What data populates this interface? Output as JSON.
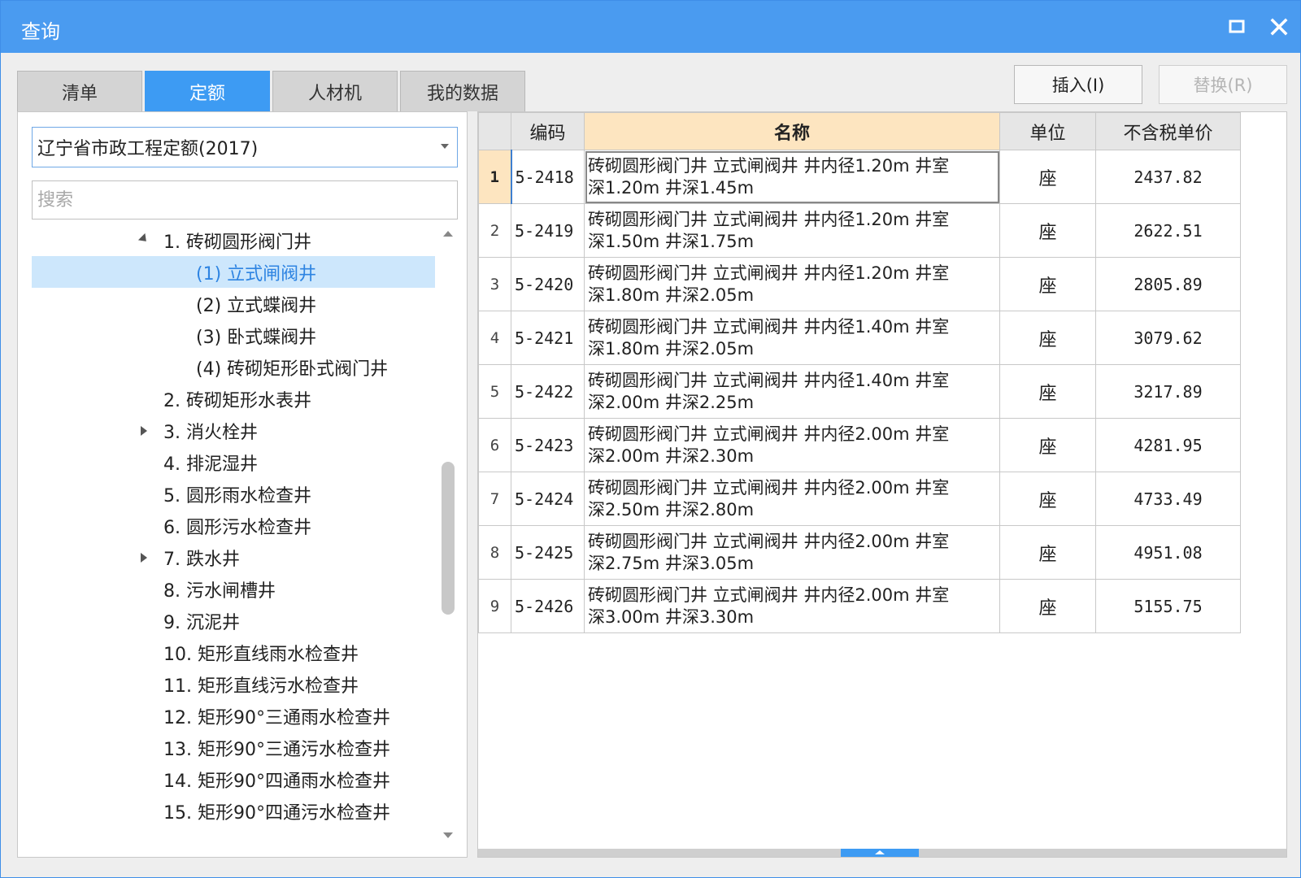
{
  "window": {
    "title": "查询",
    "colors": {
      "titlebar": "#4a9bf0",
      "active_tab": "#3d9bf3",
      "selected_row": "#cde7fc",
      "header_highlight": "#fde5c0"
    }
  },
  "tabs": [
    {
      "label": "清单",
      "active": false
    },
    {
      "label": "定额",
      "active": true
    },
    {
      "label": "人材机",
      "active": false
    },
    {
      "label": "我的数据",
      "active": false
    }
  ],
  "actions": {
    "insert_label": "插入(I)",
    "replace_label": "替换(R)"
  },
  "library": {
    "selected": "辽宁省市政工程定额(2017)"
  },
  "search": {
    "placeholder": "搜索",
    "value": ""
  },
  "tree": [
    {
      "label": "1. 砖砌圆形阀门井",
      "level": 1,
      "arrow": "expanded",
      "selected": false
    },
    {
      "label": "(1) 立式闸阀井",
      "level": 2,
      "arrow": "",
      "selected": true
    },
    {
      "label": "(2) 立式蝶阀井",
      "level": 2,
      "arrow": "",
      "selected": false
    },
    {
      "label": "(3) 卧式蝶阀井",
      "level": 2,
      "arrow": "",
      "selected": false
    },
    {
      "label": "(4) 砖砌矩形卧式阀门井",
      "level": 2,
      "arrow": "",
      "selected": false
    },
    {
      "label": "2. 砖砌矩形水表井",
      "level": 1,
      "arrow": "",
      "selected": false
    },
    {
      "label": "3. 消火栓井",
      "level": 1,
      "arrow": "collapsed",
      "selected": false
    },
    {
      "label": "4. 排泥湿井",
      "level": 1,
      "arrow": "",
      "selected": false
    },
    {
      "label": "5. 圆形雨水检查井",
      "level": 1,
      "arrow": "",
      "selected": false
    },
    {
      "label": "6. 圆形污水检查井",
      "level": 1,
      "arrow": "",
      "selected": false
    },
    {
      "label": "7. 跌水井",
      "level": 1,
      "arrow": "collapsed",
      "selected": false
    },
    {
      "label": "8. 污水闸槽井",
      "level": 1,
      "arrow": "",
      "selected": false
    },
    {
      "label": "9. 沉泥井",
      "level": 1,
      "arrow": "",
      "selected": false
    },
    {
      "label": "10. 矩形直线雨水检查井",
      "level": 1,
      "arrow": "",
      "selected": false
    },
    {
      "label": "11. 矩形直线污水检查井",
      "level": 1,
      "arrow": "",
      "selected": false
    },
    {
      "label": "12. 矩形90°三通雨水检查井",
      "level": 1,
      "arrow": "",
      "selected": false
    },
    {
      "label": "13. 矩形90°三通污水检查井",
      "level": 1,
      "arrow": "",
      "selected": false
    },
    {
      "label": "14. 矩形90°四通雨水检查井",
      "level": 1,
      "arrow": "",
      "selected": false
    },
    {
      "label": "15. 矩形90°四通污水检查井",
      "level": 1,
      "arrow": "",
      "selected": false
    }
  ],
  "table": {
    "headers": [
      "",
      "编码",
      "名称",
      "单位",
      "不含税单价"
    ],
    "rows": [
      {
        "index": "1",
        "code": "5-2418",
        "name_line1": "砖砌圆形阀门井 立式闸阀井 井内径1.20m 井室",
        "name_line2": "深1.20m 井深1.45m",
        "unit": "座",
        "price": "2437.82"
      },
      {
        "index": "2",
        "code": "5-2419",
        "name_line1": "砖砌圆形阀门井 立式闸阀井 井内径1.20m 井室",
        "name_line2": "深1.50m 井深1.75m",
        "unit": "座",
        "price": "2622.51"
      },
      {
        "index": "3",
        "code": "5-2420",
        "name_line1": "砖砌圆形阀门井 立式闸阀井 井内径1.20m 井室",
        "name_line2": "深1.80m 井深2.05m",
        "unit": "座",
        "price": "2805.89"
      },
      {
        "index": "4",
        "code": "5-2421",
        "name_line1": "砖砌圆形阀门井 立式闸阀井 井内径1.40m 井室",
        "name_line2": "深1.80m 井深2.05m",
        "unit": "座",
        "price": "3079.62"
      },
      {
        "index": "5",
        "code": "5-2422",
        "name_line1": "砖砌圆形阀门井 立式闸阀井 井内径1.40m 井室",
        "name_line2": "深2.00m 井深2.25m",
        "unit": "座",
        "price": "3217.89"
      },
      {
        "index": "6",
        "code": "5-2423",
        "name_line1": "砖砌圆形阀门井 立式闸阀井 井内径2.00m 井室",
        "name_line2": "深2.00m 井深2.30m",
        "unit": "座",
        "price": "4281.95"
      },
      {
        "index": "7",
        "code": "5-2424",
        "name_line1": "砖砌圆形阀门井 立式闸阀井 井内径2.00m 井室",
        "name_line2": "深2.50m 井深2.80m",
        "unit": "座",
        "price": "4733.49"
      },
      {
        "index": "8",
        "code": "5-2425",
        "name_line1": "砖砌圆形阀门井 立式闸阀井 井内径2.00m 井室",
        "name_line2": "深2.75m 井深3.05m",
        "unit": "座",
        "price": "4951.08"
      },
      {
        "index": "9",
        "code": "5-2426",
        "name_line1": "砖砌圆形阀门井 立式闸阀井 井内径2.00m 井室",
        "name_line2": "深3.00m 井深3.30m",
        "unit": "座",
        "price": "5155.75"
      }
    ]
  },
  "icons": {
    "maximize": "maximize-icon",
    "close": "close-icon",
    "dropdown": "chevron-down-icon"
  }
}
